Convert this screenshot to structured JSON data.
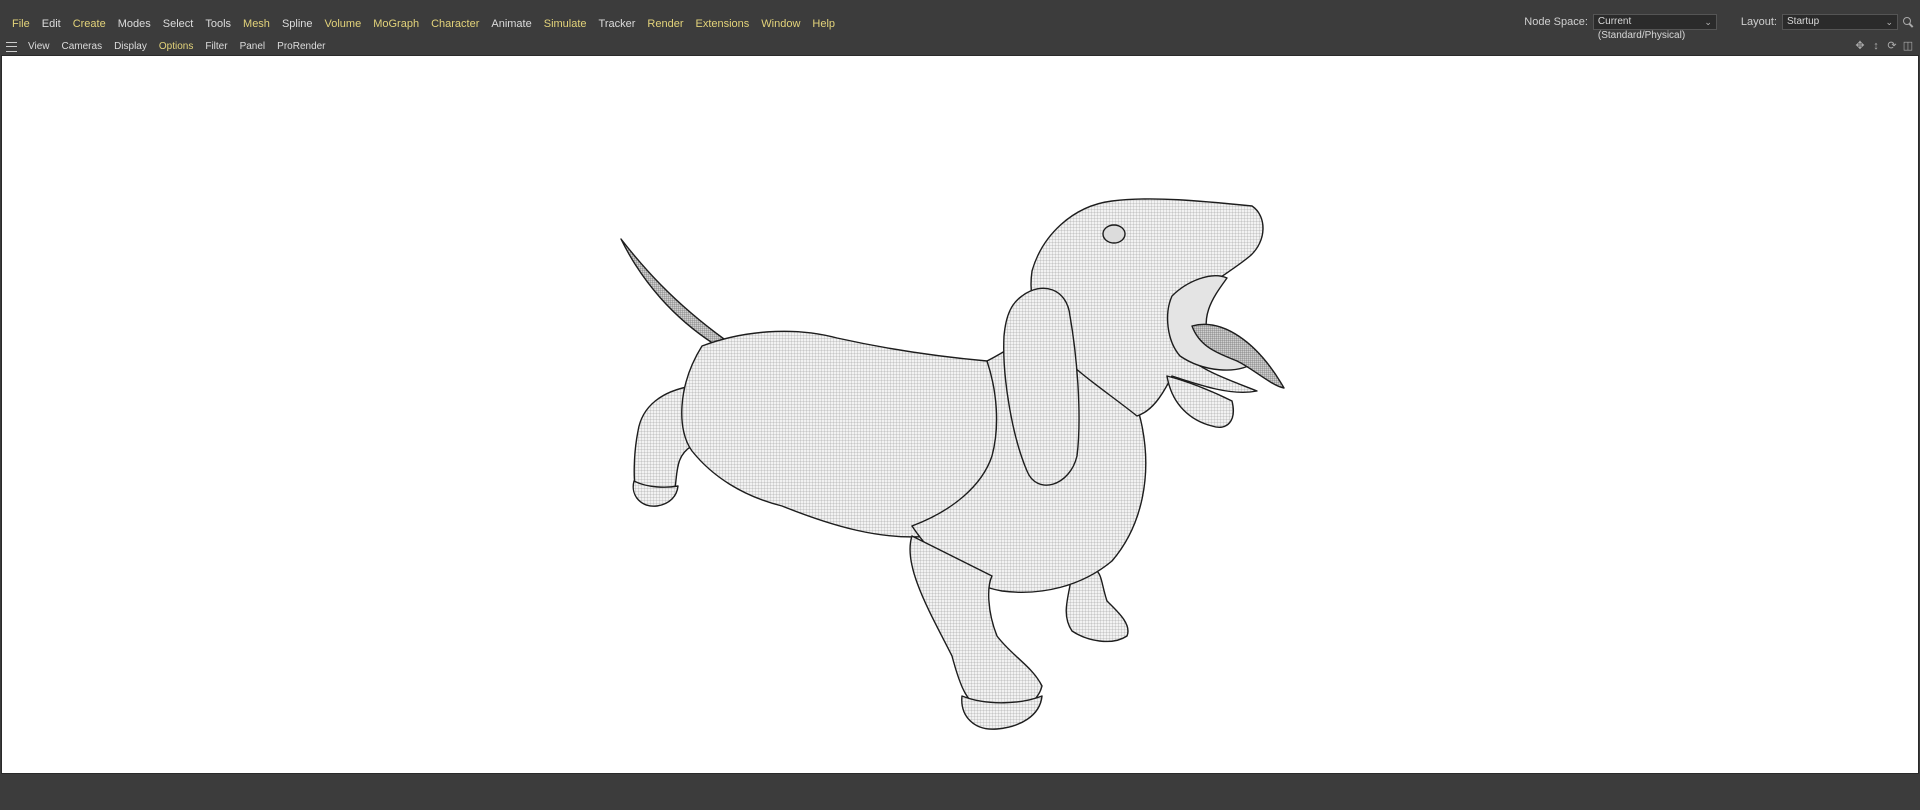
{
  "menubar": {
    "items": [
      {
        "label": "File",
        "accent": true
      },
      {
        "label": "Edit",
        "accent": false
      },
      {
        "label": "Create",
        "accent": true
      },
      {
        "label": "Modes",
        "accent": false
      },
      {
        "label": "Select",
        "accent": false
      },
      {
        "label": "Tools",
        "accent": false
      },
      {
        "label": "Mesh",
        "accent": true
      },
      {
        "label": "Spline",
        "accent": false
      },
      {
        "label": "Volume",
        "accent": true
      },
      {
        "label": "MoGraph",
        "accent": true
      },
      {
        "label": "Character",
        "accent": true
      },
      {
        "label": "Animate",
        "accent": false
      },
      {
        "label": "Simulate",
        "accent": true
      },
      {
        "label": "Tracker",
        "accent": false
      },
      {
        "label": "Render",
        "accent": true
      },
      {
        "label": "Extensions",
        "accent": true
      },
      {
        "label": "Window",
        "accent": true
      },
      {
        "label": "Help",
        "accent": true
      }
    ],
    "node_space": {
      "label": "Node Space:",
      "value": "Current (Standard/Physical)"
    },
    "layout": {
      "label": "Layout:",
      "value": "Startup"
    },
    "search_icon": "search-icon"
  },
  "viewbar": {
    "menu_icon": "hamburger-icon",
    "items": [
      {
        "label": "View",
        "accent": false
      },
      {
        "label": "Cameras",
        "accent": false
      },
      {
        "label": "Display",
        "accent": false
      },
      {
        "label": "Options",
        "accent": true
      },
      {
        "label": "Filter",
        "accent": false
      },
      {
        "label": "Panel",
        "accent": false
      },
      {
        "label": "ProRender",
        "accent": false
      }
    ],
    "nav_icons": [
      "move-view-icon",
      "zoom-view-icon",
      "rotate-view-icon",
      "toggle-view-icon"
    ]
  },
  "viewport": {
    "background": "#ffffff",
    "subject": "dachshund-wireframe-model"
  },
  "colors": {
    "ui_background": "#3c3c3c",
    "accent_menu_text": "#e3d37a",
    "normal_menu_text": "#dcdcdc"
  }
}
